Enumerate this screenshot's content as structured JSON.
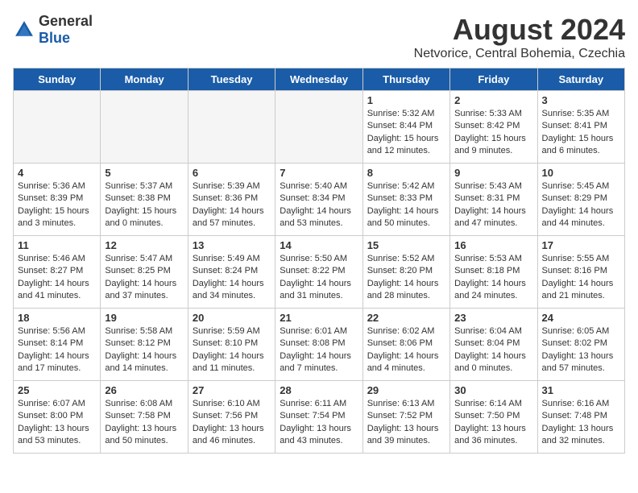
{
  "header": {
    "logo_general": "General",
    "logo_blue": "Blue",
    "month_title": "August 2024",
    "location": "Netvorice, Central Bohemia, Czechia"
  },
  "days_of_week": [
    "Sunday",
    "Monday",
    "Tuesday",
    "Wednesday",
    "Thursday",
    "Friday",
    "Saturday"
  ],
  "weeks": [
    [
      {
        "day": "",
        "empty": true
      },
      {
        "day": "",
        "empty": true
      },
      {
        "day": "",
        "empty": true
      },
      {
        "day": "",
        "empty": true
      },
      {
        "day": "1",
        "sunrise": "5:32 AM",
        "sunset": "8:44 PM",
        "daylight": "15 hours and 12 minutes."
      },
      {
        "day": "2",
        "sunrise": "5:33 AM",
        "sunset": "8:42 PM",
        "daylight": "15 hours and 9 minutes."
      },
      {
        "day": "3",
        "sunrise": "5:35 AM",
        "sunset": "8:41 PM",
        "daylight": "15 hours and 6 minutes."
      }
    ],
    [
      {
        "day": "4",
        "sunrise": "5:36 AM",
        "sunset": "8:39 PM",
        "daylight": "15 hours and 3 minutes."
      },
      {
        "day": "5",
        "sunrise": "5:37 AM",
        "sunset": "8:38 PM",
        "daylight": "15 hours and 0 minutes."
      },
      {
        "day": "6",
        "sunrise": "5:39 AM",
        "sunset": "8:36 PM",
        "daylight": "14 hours and 57 minutes."
      },
      {
        "day": "7",
        "sunrise": "5:40 AM",
        "sunset": "8:34 PM",
        "daylight": "14 hours and 53 minutes."
      },
      {
        "day": "8",
        "sunrise": "5:42 AM",
        "sunset": "8:33 PM",
        "daylight": "14 hours and 50 minutes."
      },
      {
        "day": "9",
        "sunrise": "5:43 AM",
        "sunset": "8:31 PM",
        "daylight": "14 hours and 47 minutes."
      },
      {
        "day": "10",
        "sunrise": "5:45 AM",
        "sunset": "8:29 PM",
        "daylight": "14 hours and 44 minutes."
      }
    ],
    [
      {
        "day": "11",
        "sunrise": "5:46 AM",
        "sunset": "8:27 PM",
        "daylight": "14 hours and 41 minutes."
      },
      {
        "day": "12",
        "sunrise": "5:47 AM",
        "sunset": "8:25 PM",
        "daylight": "14 hours and 37 minutes."
      },
      {
        "day": "13",
        "sunrise": "5:49 AM",
        "sunset": "8:24 PM",
        "daylight": "14 hours and 34 minutes."
      },
      {
        "day": "14",
        "sunrise": "5:50 AM",
        "sunset": "8:22 PM",
        "daylight": "14 hours and 31 minutes."
      },
      {
        "day": "15",
        "sunrise": "5:52 AM",
        "sunset": "8:20 PM",
        "daylight": "14 hours and 28 minutes."
      },
      {
        "day": "16",
        "sunrise": "5:53 AM",
        "sunset": "8:18 PM",
        "daylight": "14 hours and 24 minutes."
      },
      {
        "day": "17",
        "sunrise": "5:55 AM",
        "sunset": "8:16 PM",
        "daylight": "14 hours and 21 minutes."
      }
    ],
    [
      {
        "day": "18",
        "sunrise": "5:56 AM",
        "sunset": "8:14 PM",
        "daylight": "14 hours and 17 minutes."
      },
      {
        "day": "19",
        "sunrise": "5:58 AM",
        "sunset": "8:12 PM",
        "daylight": "14 hours and 14 minutes."
      },
      {
        "day": "20",
        "sunrise": "5:59 AM",
        "sunset": "8:10 PM",
        "daylight": "14 hours and 11 minutes."
      },
      {
        "day": "21",
        "sunrise": "6:01 AM",
        "sunset": "8:08 PM",
        "daylight": "14 hours and 7 minutes."
      },
      {
        "day": "22",
        "sunrise": "6:02 AM",
        "sunset": "8:06 PM",
        "daylight": "14 hours and 4 minutes."
      },
      {
        "day": "23",
        "sunrise": "6:04 AM",
        "sunset": "8:04 PM",
        "daylight": "14 hours and 0 minutes."
      },
      {
        "day": "24",
        "sunrise": "6:05 AM",
        "sunset": "8:02 PM",
        "daylight": "13 hours and 57 minutes."
      }
    ],
    [
      {
        "day": "25",
        "sunrise": "6:07 AM",
        "sunset": "8:00 PM",
        "daylight": "13 hours and 53 minutes."
      },
      {
        "day": "26",
        "sunrise": "6:08 AM",
        "sunset": "7:58 PM",
        "daylight": "13 hours and 50 minutes."
      },
      {
        "day": "27",
        "sunrise": "6:10 AM",
        "sunset": "7:56 PM",
        "daylight": "13 hours and 46 minutes."
      },
      {
        "day": "28",
        "sunrise": "6:11 AM",
        "sunset": "7:54 PM",
        "daylight": "13 hours and 43 minutes."
      },
      {
        "day": "29",
        "sunrise": "6:13 AM",
        "sunset": "7:52 PM",
        "daylight": "13 hours and 39 minutes."
      },
      {
        "day": "30",
        "sunrise": "6:14 AM",
        "sunset": "7:50 PM",
        "daylight": "13 hours and 36 minutes."
      },
      {
        "day": "31",
        "sunrise": "6:16 AM",
        "sunset": "7:48 PM",
        "daylight": "13 hours and 32 minutes."
      }
    ]
  ],
  "labels": {
    "sunrise": "Sunrise:",
    "sunset": "Sunset:",
    "daylight": "Daylight:"
  }
}
